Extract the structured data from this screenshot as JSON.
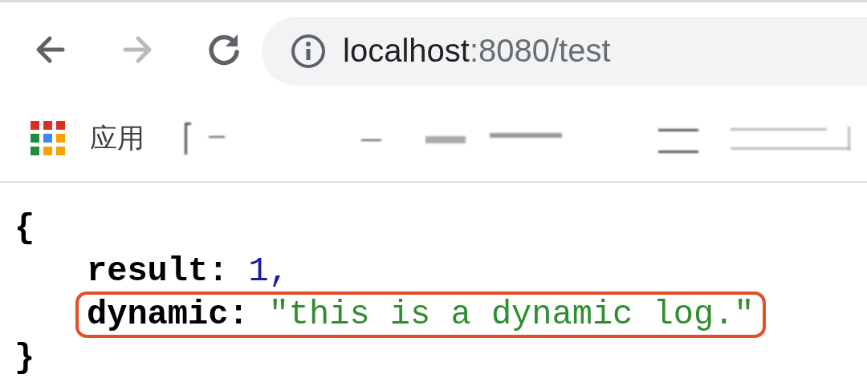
{
  "toolbar": {
    "back": {
      "disabled": false
    },
    "forward": {
      "disabled": true
    },
    "address": {
      "host": "localhost",
      "path": ":8080/test"
    }
  },
  "bookmarks": [
    {
      "label": "应用"
    }
  ],
  "json_view": {
    "open_brace": "{",
    "close_brace": "}",
    "entries": [
      {
        "key": "result:",
        "value": "1",
        "kind": "number",
        "comma": ",",
        "highlighted": false
      },
      {
        "key": "dynamic:",
        "value": "\"this is a dynamic log.\"",
        "kind": "string",
        "highlighted": true
      }
    ]
  }
}
